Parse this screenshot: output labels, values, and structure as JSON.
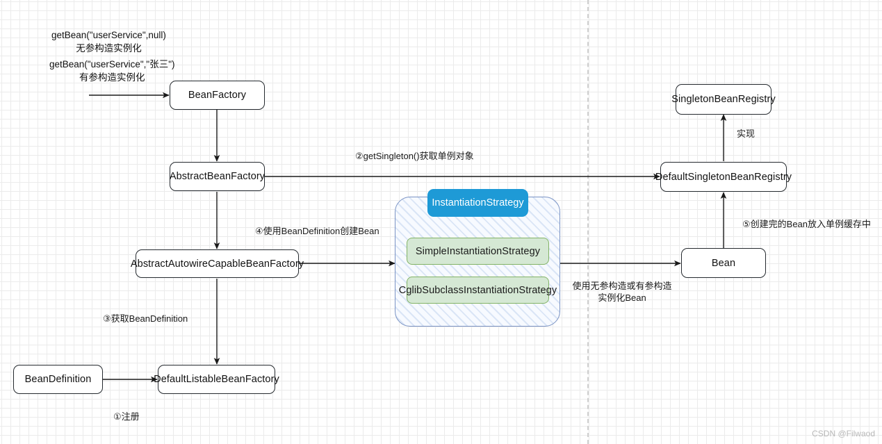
{
  "diagram": {
    "title": "Spring BeanFactory Bean creation flow",
    "watermark": "CSDN @Filwaod",
    "colors": {
      "node_border": "#24292e",
      "node_fill": "#ffffff",
      "group_border": "#7a93c4",
      "group_fill": "#f7faff",
      "group_title_fill": "#1e9ad6",
      "green_fill": "#d5e8d4",
      "green_border": "#82b366",
      "edge": "#1a1a1a",
      "grid_minor": "#ebebeb",
      "grid_major": "#d4d4d4",
      "watermark": "#b8b8b8"
    }
  },
  "captions": {
    "entry_call_1": "getBean(\"userService\",null)",
    "entry_desc_1": "无参构造实例化",
    "entry_call_2": "getBean(\"userService\",\"张三\")",
    "entry_desc_2": "有参构造实例化"
  },
  "nodes": {
    "bean_factory": "BeanFactory",
    "abstract_bean_factory": "AbstractBeanFactory",
    "abstract_autowire_capable_bean_factory": "AbstractAutowireCapableBeanFactory",
    "bean_definition": "BeanDefinition",
    "default_listable_bean_factory": "DefaultListableBeanFactory",
    "singleton_bean_registry": "SingletonBeanRegistry",
    "default_singleton_bean_registry": "DefaultSingletonBeanRegistry",
    "bean": "Bean"
  },
  "group": {
    "title": "InstantiationStrategy",
    "items": [
      "SimpleInstantiationStrategy",
      "CglibSubclassInstantiationStrategy"
    ]
  },
  "edge_labels": {
    "get_singleton": "②getSingleton()获取单例对象",
    "create_with_bean_definition": "④使用BeanDefinition创建Bean",
    "get_bean_definition": "③获取BeanDefinition",
    "register": "①注册",
    "implements": "实现",
    "instantiate_line1": "使用无参构造或有参构造",
    "instantiate_line2": "实例化Bean",
    "put_into_singleton_cache": "⑤创建完的Bean放入单例缓存中"
  }
}
